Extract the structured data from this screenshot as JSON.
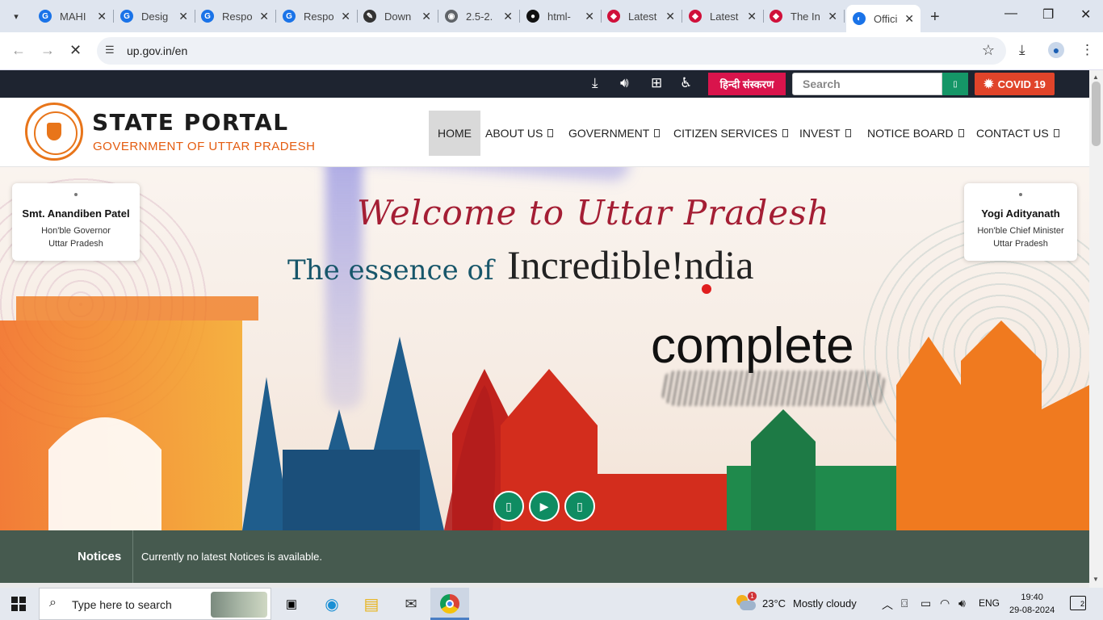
{
  "browser": {
    "tabs": [
      {
        "label": "MAHI",
        "fav_color": "#1a73e8",
        "fav": "G"
      },
      {
        "label": "Desig",
        "fav_color": "#1a73e8",
        "fav": "G"
      },
      {
        "label": "Respo",
        "fav_color": "#1a73e8",
        "fav": "G"
      },
      {
        "label": "Respo",
        "fav_color": "#1a73e8",
        "fav": "G"
      },
      {
        "label": "Down",
        "fav_color": "#333333",
        "fav": "✎"
      },
      {
        "label": "2.5-2.",
        "fav_color": "#5f6368",
        "fav": "◉"
      },
      {
        "label": "html-",
        "fav_color": "#111111",
        "fav": "●"
      },
      {
        "label": "Latest",
        "fav_color": "#d0103a",
        "fav": "◆"
      },
      {
        "label": "Latest",
        "fav_color": "#d0103a",
        "fav": "◆"
      },
      {
        "label": "The In",
        "fav_color": "#d0103a",
        "fav": "◆"
      }
    ],
    "active_tab": {
      "label": "Offici",
      "fav_color": "#1a73e8",
      "fav": "◐"
    },
    "url": "up.gov.in/en"
  },
  "topbar": {
    "hindi_label": "हिन्दी संस्करण",
    "search_placeholder": "Search",
    "covid_label": "COVID 19",
    "icons": [
      "download-icon",
      "audio-icon",
      "sitemap-icon",
      "accessibility-icon"
    ]
  },
  "header": {
    "title": "STATE PORTAL",
    "subtitle": "GOVERNMENT OF UTTAR PRADESH",
    "nav": [
      "HOME",
      "ABOUT US",
      "GOVERNMENT",
      "CITIZEN SERVICES",
      "INVEST",
      "NOTICE BOARD",
      "CONTACT US"
    ]
  },
  "hero": {
    "welcome": "Welcome to Uttar Pradesh",
    "essence": "The essence of",
    "incredible": "Incredible!ndia",
    "overlay_text": "complete",
    "governor": {
      "name": "Smt. Anandiben Patel",
      "role1": "Hon'ble Governor",
      "role2": "Uttar Pradesh"
    },
    "cm": {
      "name": "Yogi Adityanath",
      "role1": "Hon'ble Chief Minister",
      "role2": "Uttar Pradesh"
    },
    "controls": [
      "prev-icon",
      "play-icon",
      "next-icon"
    ]
  },
  "notices": {
    "label": "Notices",
    "text": "Currently no latest Notices is available."
  },
  "taskbar": {
    "search_placeholder": "Type here to search",
    "weather_temp": "23°C",
    "weather_desc": "Mostly cloudy",
    "weather_badge": "1",
    "lang": "ENG",
    "time": "19:40",
    "date": "29-08-2024",
    "notif_count": "2"
  }
}
